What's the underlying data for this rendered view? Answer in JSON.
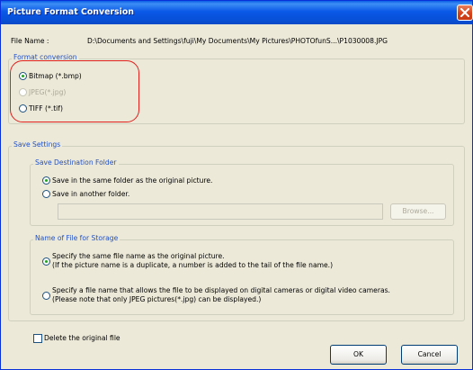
{
  "window": {
    "title": "Picture Format Conversion"
  },
  "file": {
    "label": "File Name :",
    "value": "D:\\Documents and Settings\\fuji\\My Documents\\My Pictures\\PHOTOfunS...\\P1030008.JPG"
  },
  "format_conversion": {
    "label": "Format conversion",
    "options": [
      {
        "label": "Bitmap (*.bmp)",
        "checked": true,
        "enabled": true
      },
      {
        "label": "JPEG(*.jpg)",
        "checked": false,
        "enabled": false
      },
      {
        "label": "TIFF (*.tif)",
        "checked": false,
        "enabled": true
      }
    ]
  },
  "save_settings": {
    "label": "Save Settings",
    "destination": {
      "label": "Save Destination Folder",
      "options": [
        {
          "label": "Save in the same folder as the original picture.",
          "checked": true
        },
        {
          "label": "Save in another folder.",
          "checked": false
        }
      ],
      "path_value": "",
      "browse_label": "Browse..."
    },
    "file_name": {
      "label": "Name of File for Storage",
      "option1_line1": "Specify the same file name as the original picture.",
      "option1_line2": "(If the picture name is a duplicate, a number is added to the tail of the file name.)",
      "option2_line1": "Specify a file name that allows the file to be displayed on digital cameras or digital video cameras.",
      "option2_line2": "(Please note that only JPEG pictures(*.jpg) can be displayed.)",
      "option1_checked": true,
      "option2_checked": false
    }
  },
  "delete_original": {
    "label": "Delete the original file",
    "checked": false
  },
  "buttons": {
    "ok": "OK",
    "cancel": "Cancel"
  },
  "colors": {
    "titlebar": "#0a55e0",
    "group_label": "#2251c7",
    "highlight": "#e0201d",
    "window_bg": "#ece9d8"
  }
}
